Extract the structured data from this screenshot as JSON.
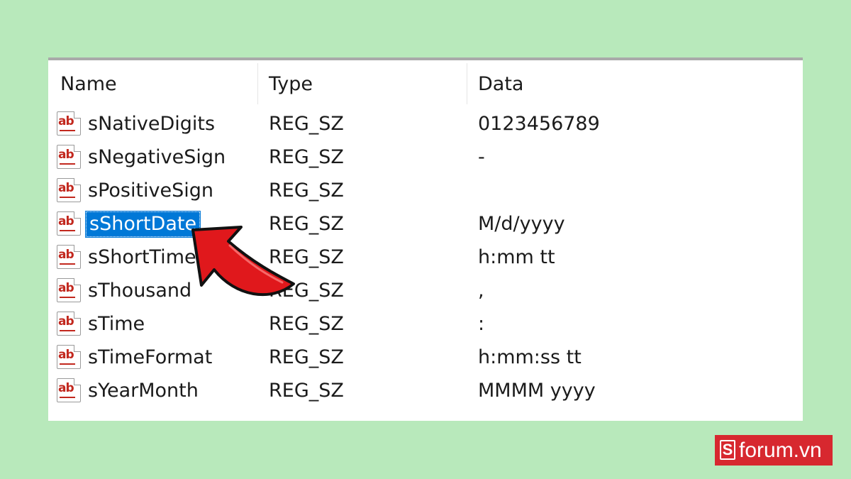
{
  "columns": {
    "name": "Name",
    "type": "Type",
    "data": "Data"
  },
  "icon": {
    "glyph": "ab",
    "semantic": "string-value-icon"
  },
  "rows": [
    {
      "name": "sNativeDigits",
      "type": "REG_SZ",
      "data": "0123456789"
    },
    {
      "name": "sNegativeSign",
      "type": "REG_SZ",
      "data": "-"
    },
    {
      "name": "sPositiveSign",
      "type": "REG_SZ",
      "data": ""
    },
    {
      "name": "sShortDate",
      "type": "REG_SZ",
      "data": "M/d/yyyy",
      "selected": true
    },
    {
      "name": "sShortTime",
      "type": "REG_SZ",
      "data": "h:mm tt"
    },
    {
      "name": "sThousand",
      "type": "REG_SZ",
      "data": ","
    },
    {
      "name": "sTime",
      "type": "REG_SZ",
      "data": ":"
    },
    {
      "name": "sTimeFormat",
      "type": "REG_SZ",
      "data": "h:mm:ss tt"
    },
    {
      "name": "sYearMonth",
      "type": "REG_SZ",
      "data": "MMMM yyyy"
    }
  ],
  "watermark": {
    "letter": "S",
    "text": "forum.vn"
  },
  "colors": {
    "background": "#b8e9bb",
    "selection": "#0078d7",
    "arrow": "#e0181c",
    "brand": "#d7282f"
  }
}
